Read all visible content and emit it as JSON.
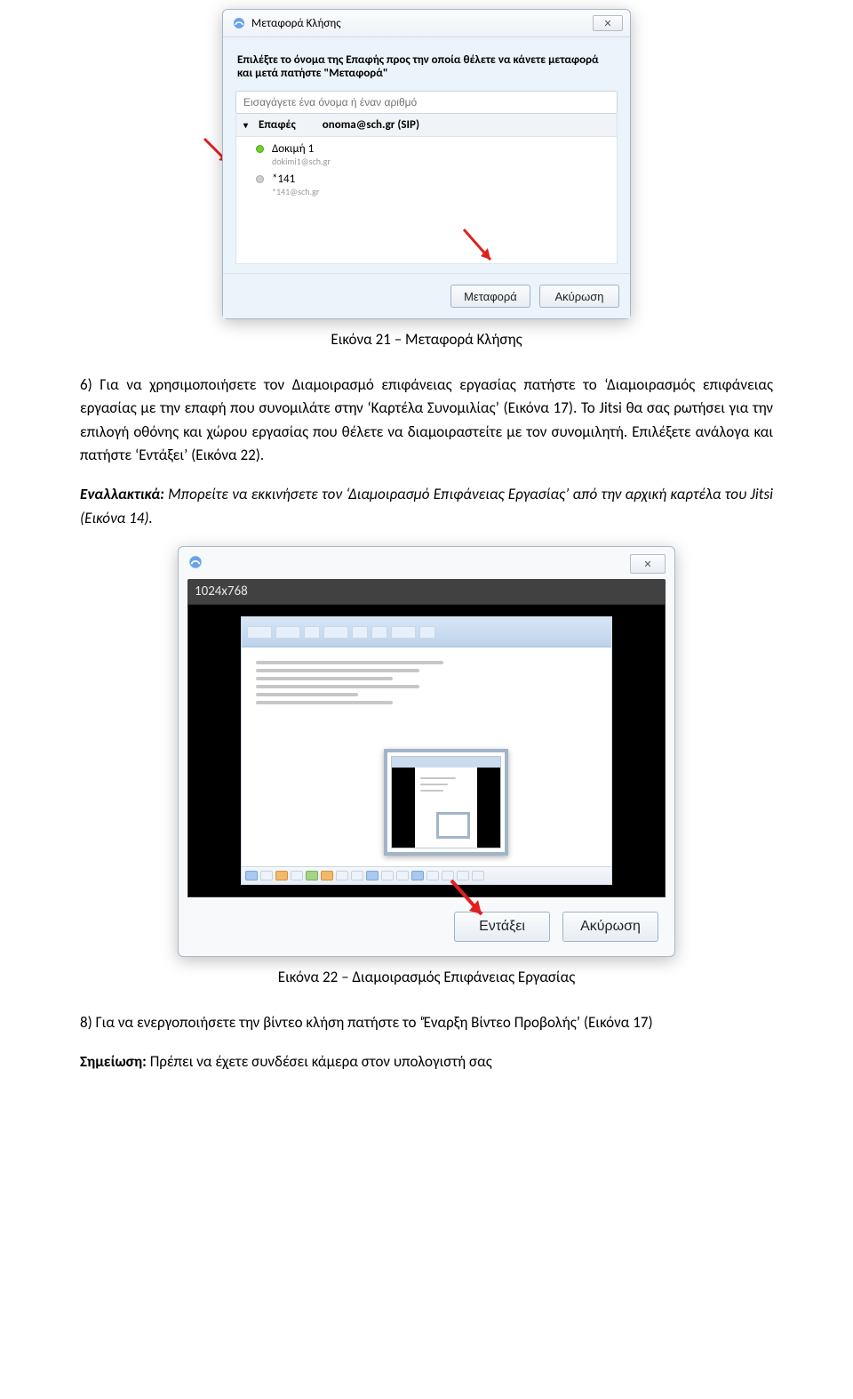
{
  "dialog1": {
    "title": "Μεταφορά Κλήσης",
    "close_glyph": "✕",
    "prompt": "Επιλέξτε το όνομα της Επαφής προς την οποία θέλετε να κάνετε μεταφορά και μετά πατήστε \"Μεταφορά\"",
    "search_placeholder": "Εισαγάγετε ένα όνομα ή έναν αριθμό",
    "contacts_header_label": "Επαφές",
    "contacts_header_account": "onoma@sch.gr (SIP)",
    "contacts": [
      {
        "name": "Δοκιμή 1",
        "sub": "dokimi1@sch.gr",
        "status": "green"
      },
      {
        "name": "*141",
        "sub": "*141@sch.gr",
        "status": "gray"
      }
    ],
    "transfer_btn": "Μεταφορά",
    "cancel_btn": "Ακύρωση"
  },
  "caption1": "Εικόνα 21 – Μεταφορά Κλήσης",
  "para1_prefix": "6) Για να χρησιμοποιήσετε τον Διαμοιρασμό επιφάνειας εργασίας πατήστε το ‘Διαμοιρασμός επιφάνειας εργασίας με την επαφή που συνομιλάτε στην ‘Καρτέλα Συνομιλίας’ (Εικόνα 17). Το Jitsi θα σας ρωτήσει για την επιλογή οθόνης και χώρου εργασίας που θέλετε να διαμοιραστείτε με τον συνομιλητή. Επιλέξετε ανάλογα και πατήστε ‘Εντάξει’ (Εικόνα 22).",
  "para2_label": "Εναλλακτικά:",
  "para2_rest": " Μπορείτε να εκκινήσετε τον ‘Διαμοιρασμό Επιφάνειας Εργασίας’ από την αρχική καρτέλα του Jitsi (Εικόνα 14).",
  "dialog2": {
    "close_glyph": "✕",
    "resolution": "1024x768",
    "ok_btn": "Εντάξει",
    "cancel_btn": "Ακύρωση"
  },
  "caption2": "Εικόνα 22 – Διαμοιρασμός Επιφάνειας Εργασίας",
  "para3": "8) Για να ενεργοποιήσετε την βίντεο κλήση πατήστε το ‘Έναρξη Βίντεο Προβολής’ (Εικόνα 17)",
  "para4_label": "Σημείωση:",
  "para4_rest": " Πρέπει να έχετε συνδέσει κάμερα στον υπολογιστή σας"
}
